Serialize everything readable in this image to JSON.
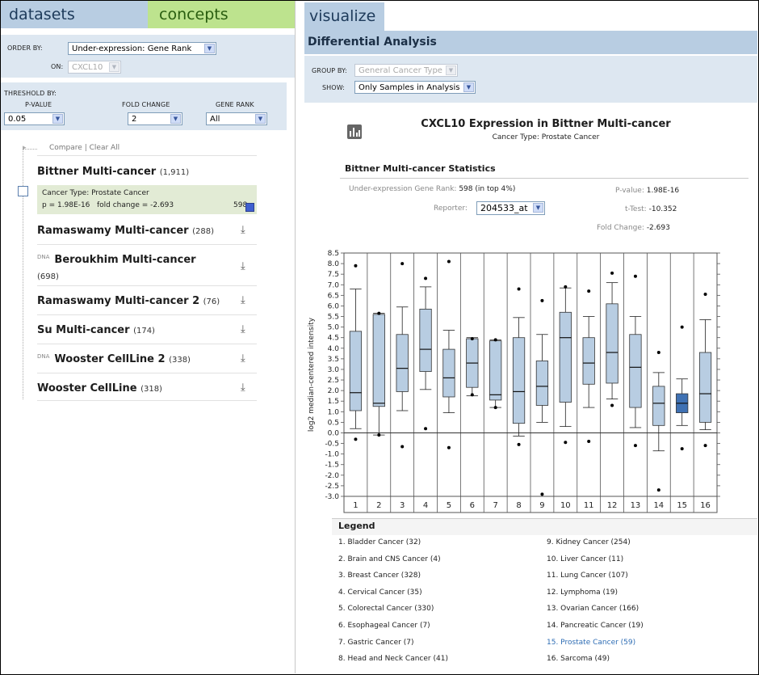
{
  "left": {
    "tabs": {
      "datasets": "datasets",
      "concepts": "concepts"
    },
    "order_by": {
      "label": "ORDER BY:",
      "value": "Under-expression: Gene Rank"
    },
    "on": {
      "label": "ON:",
      "value": "CXCL10"
    },
    "threshold": {
      "label": "THRESHOLD BY:",
      "pvalue_label": "P-VALUE",
      "pvalue": "0.05",
      "fold_label": "FOLD CHANGE",
      "fold": "2",
      "rank_label": "GENE RANK",
      "rank": "All"
    },
    "compare": "Compare",
    "separator": "|",
    "clear_all": "Clear All",
    "datasets": [
      {
        "name": "Bittner Multi-cancer",
        "count": "(1,911)",
        "dna": ""
      },
      {
        "name": "Ramaswamy Multi-cancer",
        "count": "(288)",
        "dna": ""
      },
      {
        "name": "Beroukhim Multi-cancer",
        "count": "(698)",
        "dna": "DNA"
      },
      {
        "name": "Ramaswamy Multi-cancer 2",
        "count": "(76)",
        "dna": ""
      },
      {
        "name": "Su Multi-cancer",
        "count": "(174)",
        "dna": ""
      },
      {
        "name": "Wooster CellLine 2",
        "count": "(338)",
        "dna": "DNA"
      },
      {
        "name": "Wooster CellLine",
        "count": "(318)",
        "dna": ""
      }
    ],
    "selected_analysis": {
      "line1": "Cancer Type: Prostate Cancer",
      "line2": "p = 1.98E-16   fold change = -2.693",
      "rank": "598"
    }
  },
  "right": {
    "tab": "visualize",
    "section": "Differential Analysis",
    "group_by": {
      "label": "GROUP BY:",
      "value": "General Cancer Type"
    },
    "show": {
      "label": "SHOW:",
      "value": "Only Samples in Analysis"
    },
    "title": "CXCL10 Expression in Bittner Multi-cancer",
    "subtitle": "Cancer Type: Prostate Cancer",
    "stats_title": "Bittner Multi-cancer Statistics",
    "stats": {
      "gene_rank_label": "Under-expression Gene Rank:",
      "gene_rank": "598 (in top 4%)",
      "reporter_label": "Reporter:",
      "reporter": "204533_at",
      "pvalue_label": "P-value:",
      "pvalue": "1.98E-16",
      "ttest_label": "t-Test:",
      "ttest": "-10.352",
      "fold_label": "Fold Change:",
      "fold": "-2.693"
    },
    "legend_title": "Legend",
    "legend": [
      "1. Bladder Cancer (32)",
      "2. Brain and CNS Cancer (4)",
      "3. Breast Cancer (328)",
      "4. Cervical Cancer (35)",
      "5. Colorectal Cancer (330)",
      "6. Esophageal Cancer (7)",
      "7. Gastric Cancer (7)",
      "8. Head and Neck Cancer (41)",
      "9. Kidney Cancer (254)",
      "10. Liver Cancer (11)",
      "11. Lung Cancer (107)",
      "12. Lymphoma (19)",
      "13. Ovarian Cancer (166)",
      "14. Pancreatic Cancer (19)",
      "15. Prostate Cancer (59)",
      "16. Sarcoma (49)"
    ]
  },
  "chart_data": {
    "type": "box",
    "ylabel": "log2 median-centered intensity",
    "ylim": [
      -3.0,
      8.5
    ],
    "yticks": [
      8.5,
      8.0,
      7.5,
      7.0,
      6.5,
      6.0,
      5.5,
      5.0,
      4.5,
      4.0,
      3.5,
      3.0,
      2.5,
      2.0,
      1.5,
      1.0,
      0.5,
      0.0,
      -0.5,
      -1.0,
      -1.5,
      -2.0,
      -2.5,
      -3.0
    ],
    "categories": [
      "1",
      "2",
      "3",
      "4",
      "5",
      "6",
      "7",
      "8",
      "9",
      "10",
      "11",
      "12",
      "13",
      "14",
      "15",
      "16"
    ],
    "highlight_category": "15",
    "box_color": "#b8cde2",
    "highlight_color": "#3f71b3",
    "boxes": [
      {
        "wl": 0.2,
        "q1": 1.05,
        "med": 1.9,
        "q3": 4.8,
        "wh": 6.8,
        "outliers": [
          7.9,
          -0.3
        ]
      },
      {
        "wl": -0.1,
        "q1": 1.25,
        "med": 1.4,
        "q3": 5.6,
        "wh": 5.65,
        "outliers": [
          5.65,
          -0.1
        ]
      },
      {
        "wl": 1.05,
        "q1": 1.95,
        "med": 3.05,
        "q3": 4.65,
        "wh": 5.95,
        "outliers": [
          8.0,
          -0.65
        ]
      },
      {
        "wl": 2.05,
        "q1": 2.9,
        "med": 3.95,
        "q3": 5.85,
        "wh": 6.9,
        "outliers": [
          7.3,
          0.2
        ]
      },
      {
        "wl": 0.95,
        "q1": 1.7,
        "med": 2.6,
        "q3": 3.95,
        "wh": 4.85,
        "outliers": [
          8.1,
          -0.7
        ]
      },
      {
        "wl": 1.75,
        "q1": 2.15,
        "med": 3.3,
        "q3": 4.45,
        "wh": 4.5,
        "outliers": [
          4.45,
          1.8
        ]
      },
      {
        "wl": 1.2,
        "q1": 1.55,
        "med": 1.8,
        "q3": 4.35,
        "wh": 4.4,
        "outliers": [
          4.4,
          1.2
        ]
      },
      {
        "wl": -0.15,
        "q1": 0.45,
        "med": 1.95,
        "q3": 4.5,
        "wh": 5.45,
        "outliers": [
          6.8,
          -0.55
        ]
      },
      {
        "wl": 0.5,
        "q1": 1.3,
        "med": 2.2,
        "q3": 3.4,
        "wh": 4.65,
        "outliers": [
          6.25,
          -2.9
        ]
      },
      {
        "wl": 0.3,
        "q1": 1.45,
        "med": 4.5,
        "q3": 5.7,
        "wh": 6.85,
        "outliers": [
          6.9,
          -0.45
        ]
      },
      {
        "wl": 1.2,
        "q1": 2.3,
        "med": 3.3,
        "q3": 4.5,
        "wh": 5.5,
        "outliers": [
          6.7,
          -0.4
        ]
      },
      {
        "wl": 1.6,
        "q1": 2.35,
        "med": 3.8,
        "q3": 6.1,
        "wh": 7.1,
        "outliers": [
          7.55,
          1.3
        ]
      },
      {
        "wl": 0.25,
        "q1": 1.2,
        "med": 3.1,
        "q3": 4.65,
        "wh": 5.5,
        "outliers": [
          7.4,
          -0.6
        ]
      },
      {
        "wl": -0.85,
        "q1": 0.35,
        "med": 1.4,
        "q3": 2.2,
        "wh": 2.85,
        "outliers": [
          3.8,
          -2.7
        ]
      },
      {
        "wl": 0.35,
        "q1": 0.95,
        "med": 1.4,
        "q3": 1.85,
        "wh": 2.55,
        "outliers": [
          5.0,
          -0.75
        ]
      },
      {
        "wl": 0.15,
        "q1": 0.5,
        "med": 1.85,
        "q3": 3.8,
        "wh": 5.35,
        "outliers": [
          6.55,
          -0.6
        ]
      }
    ]
  }
}
